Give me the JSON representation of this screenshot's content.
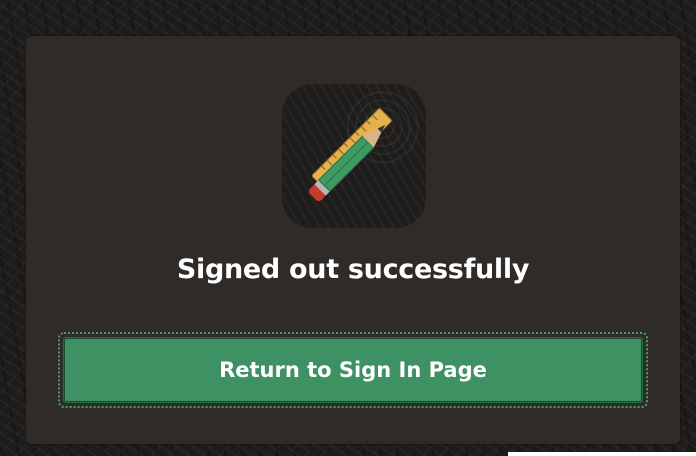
{
  "dialog": {
    "heading": "Signed out successfully",
    "return_button_label": "Return to Sign In Page"
  },
  "icon": {
    "semantic": "pencil-and-ruler-icon",
    "colors": {
      "tile": "#1f1d1b",
      "ruler": "#e3b24c",
      "pencil_body": "#3d9a62",
      "eraser": "#c63b2b",
      "ferrule": "#b8b8b8",
      "wood": "#d9b48a",
      "lead": "#333333"
    }
  },
  "colors": {
    "page_background": "#1e1c1a",
    "card_background": "#2e2b29",
    "button_background": "#3e9163",
    "button_text": "#ffffff",
    "heading_text": "#ffffff"
  }
}
